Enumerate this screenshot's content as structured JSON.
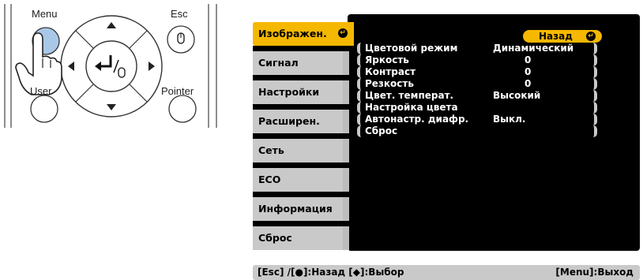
{
  "remote": {
    "menu_label": "Menu",
    "esc_label": "Esc",
    "user_label": "User",
    "pointer_label": "Pointer"
  },
  "menu": {
    "tabs": [
      {
        "label": "Изображен.",
        "active": true
      },
      {
        "label": "Сигнал",
        "active": false
      },
      {
        "label": "Настройки",
        "active": false
      },
      {
        "label": "Расширен.",
        "active": false
      },
      {
        "label": "Сеть",
        "active": false
      },
      {
        "label": "ECO",
        "active": false
      },
      {
        "label": "Информация",
        "active": false
      },
      {
        "label": "Сброс",
        "active": false
      }
    ],
    "back_label": "Назад",
    "items": [
      {
        "label": "Цветовой режим",
        "value": "Динамический"
      },
      {
        "label": "Яркость",
        "value": "0"
      },
      {
        "label": "Контраст",
        "value": "0"
      },
      {
        "label": "Резкость",
        "value": "0"
      },
      {
        "label": "Цвет. температ.",
        "value": "Высокий"
      },
      {
        "label": "Настройка цвета",
        "value": ""
      },
      {
        "label": "Автонастр. диафр.",
        "value": "Выкл."
      },
      {
        "label": "Сброс",
        "value": ""
      }
    ]
  },
  "help": {
    "left": "[Esc] /[●]:Назад  [◆]:Выбор",
    "right": "[Menu]:Выход"
  },
  "colors": {
    "accent": "#f5b800",
    "tab_bg": "#c9c9c9",
    "panel_bg": "#000000"
  }
}
